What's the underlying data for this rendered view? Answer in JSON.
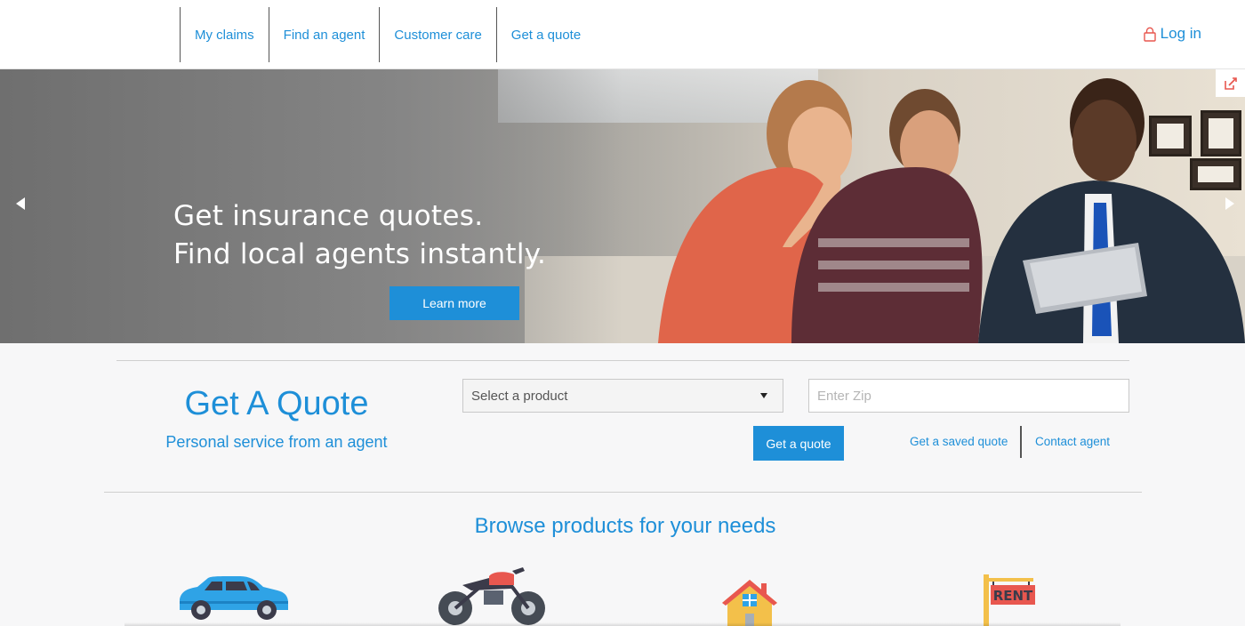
{
  "nav": {
    "items": [
      {
        "label": "My claims"
      },
      {
        "label": "Find an agent"
      },
      {
        "label": "Customer care"
      },
      {
        "label": "Get a quote"
      }
    ],
    "login_label": "Log in",
    "login_icon": "lock-icon"
  },
  "hero": {
    "headline_line1": "Get insurance quotes.",
    "headline_line2": "Find local agents instantly.",
    "cta_label": "Learn more",
    "prev_icon": "arrow-left-icon",
    "next_icon": "arrow-right-icon",
    "feedback_icon": "external-edit-icon"
  },
  "quote": {
    "title": "Get A Quote",
    "subtitle": "Personal service from an agent",
    "product_select": {
      "selected": "Select a product"
    },
    "zip": {
      "placeholder": "Enter Zip",
      "value": ""
    },
    "submit_label": "Get a quote",
    "saved_quote_label": "Get a saved quote",
    "contact_agent_label": "Contact agent"
  },
  "browse": {
    "title": "Browse products for your needs",
    "products": [
      {
        "icon": "car-icon"
      },
      {
        "icon": "motorcycle-icon"
      },
      {
        "icon": "house-icon"
      },
      {
        "icon": "rent-sign-icon",
        "sign_text": "RENT"
      }
    ]
  },
  "colors": {
    "accent": "#1e8fd8",
    "login_icon": "#e8574f"
  }
}
